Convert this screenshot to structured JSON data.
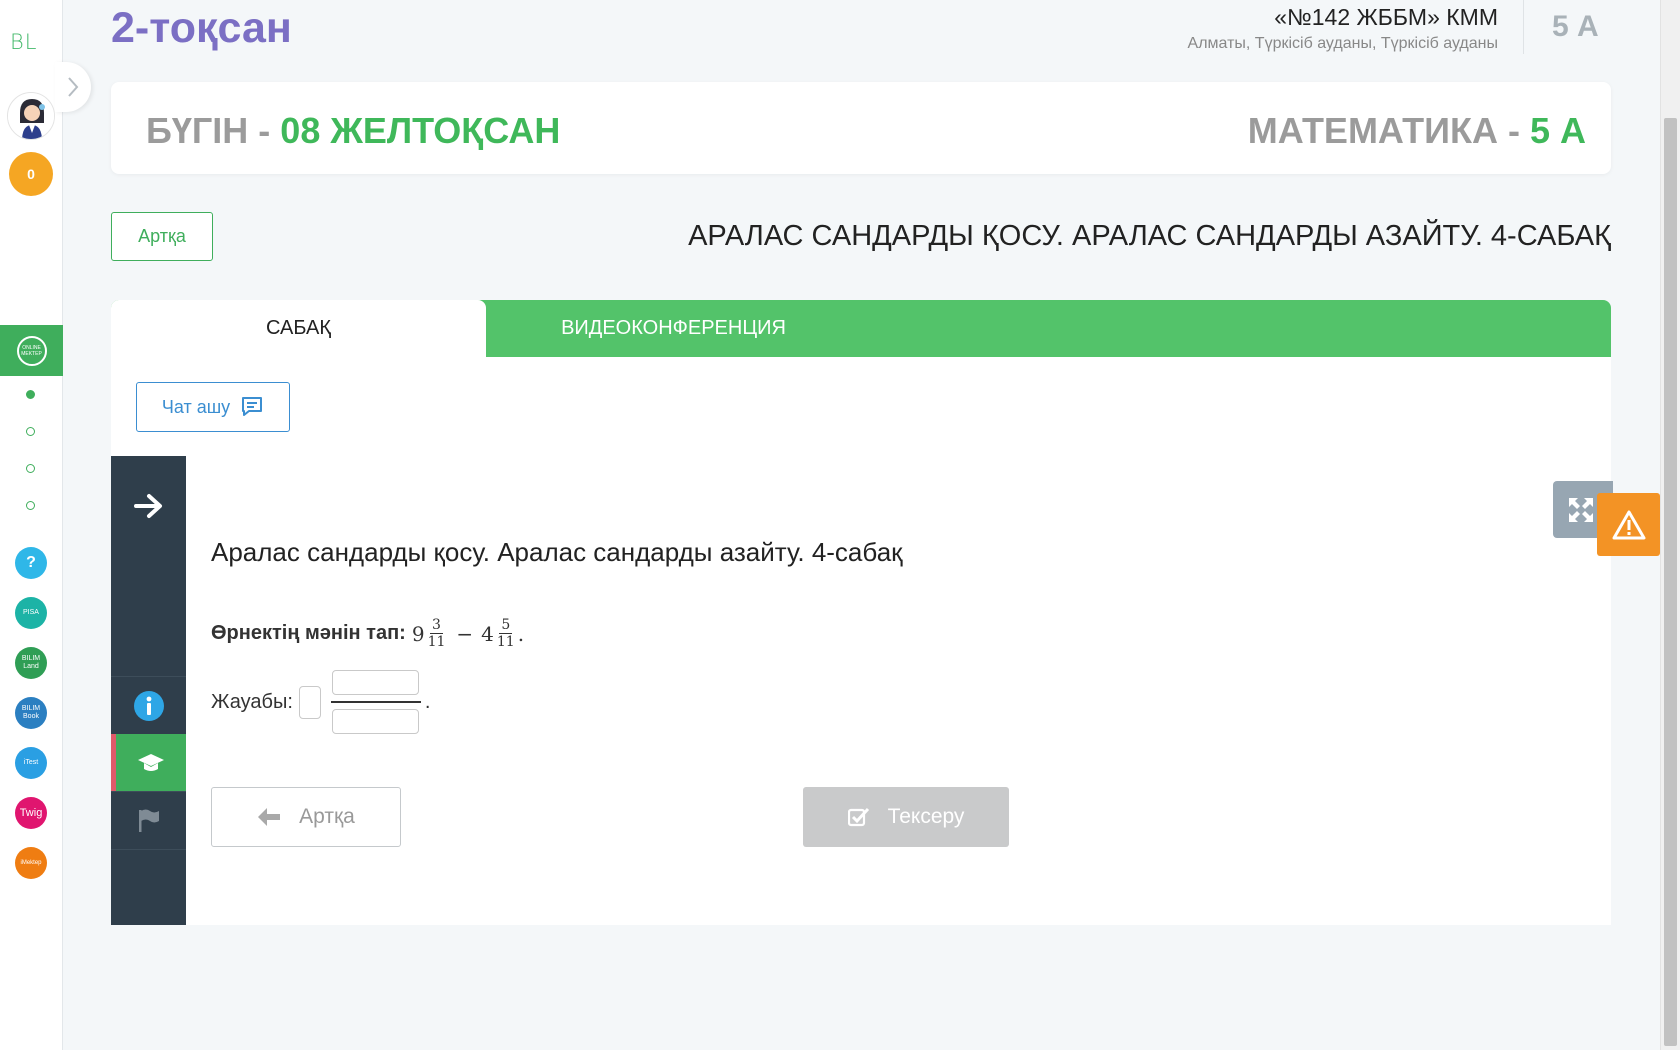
{
  "rail": {
    "logo": "BL",
    "badge_count": "0",
    "active_item": "Online Mektep",
    "apps": [
      {
        "icon": "help-icon",
        "label": "?",
        "color": "#2fb7e8"
      },
      {
        "icon": "pisa-icon",
        "label": "PISA",
        "color": "#1cb3a6"
      },
      {
        "icon": "bilimland-icon",
        "label": "BILIM Land",
        "color": "#2f9e55"
      },
      {
        "icon": "bilimbook-icon",
        "label": "BILIM Book",
        "color": "#2b7fc1"
      },
      {
        "icon": "itest-icon",
        "label": "iTest",
        "color": "#2a9fe3"
      },
      {
        "icon": "twig-icon",
        "label": "Twig",
        "color": "#e0156f"
      },
      {
        "icon": "idealtrip-icon",
        "label": "iMektep",
        "color": "#ef7d12"
      }
    ]
  },
  "header": {
    "quarter": "2-тоқсан",
    "school_name": "«№142 ЖББМ» КММ",
    "school_address": "Алматы, Түркісіб ауданы, Түркісіб ауданы",
    "class": "5 А"
  },
  "date_card": {
    "today_label": "БҮГІН - ",
    "today_date": "08 ЖЕЛТОҚСАН",
    "subject_label": "МАТЕМАТИКА - ",
    "subject_class": "5 А"
  },
  "lesson": {
    "back_label": "Артқа",
    "title": "АРАЛАС САНДАРДЫ ҚОСУ. АРАЛАС САНДАРДЫ АЗАЙТУ. 4-САБАҚ"
  },
  "tabs": [
    {
      "label": "САБАҚ",
      "active": true
    },
    {
      "label": "ВИДЕОКОНФЕРЕНЦИЯ",
      "active": false
    }
  ],
  "content": {
    "chat_label": "Чат ашу",
    "task_title": "Аралас сандарды қосу. Аралас сандарды азайту. 4-сабақ",
    "question_label": "Өрнектің мәнін тап:",
    "expr": {
      "a_whole": "9",
      "a_num": "3",
      "a_den": "11",
      "op": "−",
      "b_whole": "4",
      "b_num": "5",
      "b_den": "11",
      "end": "."
    },
    "answer_label": "Жауабы:",
    "answer_end": ".",
    "back_button": "Артқа",
    "check_button": "Тексеру"
  },
  "colors": {
    "accent_green": "#3fb85a",
    "tab_green": "#53c36a",
    "quarter_purple": "#7b6fc4",
    "nav_dark": "#2f3e4b",
    "warning_orange": "#f39325",
    "chat_blue": "#3b8ed1"
  }
}
